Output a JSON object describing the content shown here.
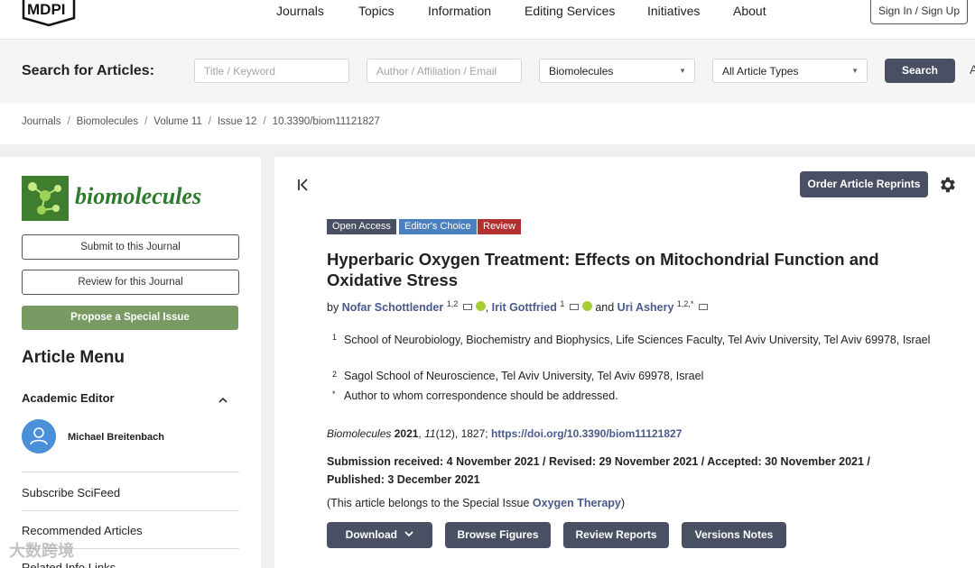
{
  "nav": {
    "logo_text": "MDPI",
    "items": [
      "Journals",
      "Topics",
      "Information",
      "Editing Services",
      "Initiatives",
      "About"
    ],
    "signin_label": "Sign In / Sign Up"
  },
  "search": {
    "title": "Search for Articles:",
    "title_placeholder": "Title / Keyword",
    "author_placeholder": "Author / Affiliation / Email",
    "journal_value": "Biomolecules",
    "type_value": "All Article Types",
    "button_label": "Search",
    "extra_label": "A"
  },
  "breadcrumb": [
    "Journals",
    "Biomolecules",
    "Volume 11",
    "Issue 12",
    "10.3390/biom11121827"
  ],
  "sidebar": {
    "journal_name": "biomolecules",
    "submit_label": "Submit to this Journal",
    "review_label": "Review for this Journal",
    "propose_label": "Propose a Special Issue",
    "article_menu_title": "Article Menu",
    "academic_editor_title": "Academic Editor",
    "editor_name": "Michael Breitenbach",
    "links": [
      "Subscribe SciFeed",
      "Recommended Articles",
      "Related Info Links"
    ]
  },
  "article": {
    "reprints_label": "Order Article Reprints",
    "badges": [
      {
        "label": "Open Access",
        "color": "#4a5063"
      },
      {
        "label": "Editor's Choice",
        "color": "#4a7fc0"
      },
      {
        "label": "Review",
        "color": "#b0312f"
      }
    ],
    "title": "Hyperbaric Oxygen Treatment: Effects on Mitochondrial Function and Oxidative Stress",
    "by": "by",
    "authors": [
      {
        "name": "Nofar Schottlender",
        "sup": "1,2"
      },
      {
        "name": "Irit Gottfried",
        "sup": "1"
      },
      {
        "name": "Uri Ashery",
        "sup": "1,2,*"
      }
    ],
    "and": "and",
    "affiliations": [
      {
        "num": "1",
        "text": "School of Neurobiology, Biochemistry and Biophysics, Life Sciences Faculty, Tel Aviv University, Tel Aviv 69978, Israel"
      },
      {
        "num": "2",
        "text": "Sagol School of Neuroscience, Tel Aviv University, Tel Aviv 69978, Israel"
      },
      {
        "num": "*",
        "text": "Author to whom correspondence should be addressed."
      }
    ],
    "citation": {
      "journal": "Biomolecules",
      "year": "2021",
      "volume": "11",
      "issue_pages": "(12), 1827;",
      "doi_link": "https://doi.org/10.3390/biom11121827"
    },
    "dates": "Submission received: 4 November 2021 / Revised: 29 November 2021 / Accepted: 30 November 2021 / Published: 3 December 2021",
    "special_issue_prefix": "(This article belongs to the Special Issue ",
    "special_issue_name": "Oxygen Therapy",
    "special_issue_suffix": ")",
    "buttons": {
      "download": "Download",
      "browse": "Browse Figures",
      "review": "Review Reports",
      "versions": "Versions Notes"
    }
  },
  "watermark": "大数跨境"
}
